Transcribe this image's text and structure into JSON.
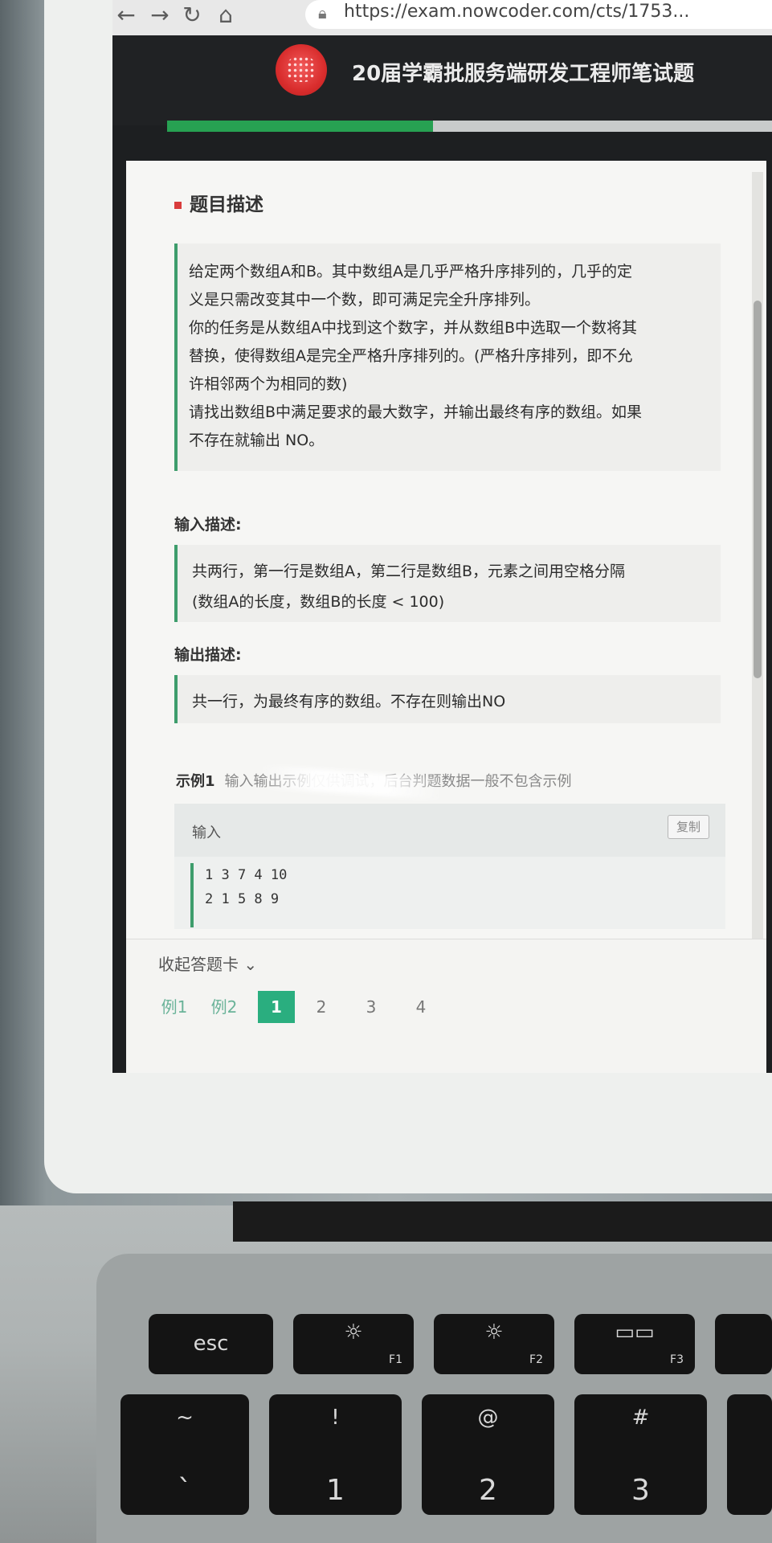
{
  "browser": {
    "url": "https://exam.nowcoder.com/cts/1753..."
  },
  "header": {
    "exam_title": "20届学霸批服务端研发工程师笔试题",
    "progress_fraction": 0.44
  },
  "problem": {
    "section_title": "题目描述",
    "description_lines": [
      "给定两个数组A和B。其中数组A是几乎严格升序排列的，几乎的定",
      "义是只需改变其中一个数，即可满足完全升序排列。",
      "你的任务是从数组A中找到这个数字，并从数组B中选取一个数将其",
      "替换，使得数组A是完全严格升序排列的。(严格升序排列，即不允",
      "许相邻两个为相同的数)",
      "请找出数组B中满足要求的最大数字，并输出最终有序的数组。如果",
      "不存在就输出 NO。"
    ],
    "input_label": "输入描述:",
    "input_lines": [
      "共两行，第一行是数组A，第二行是数组B，元素之间用空格分隔",
      "(数组A的长度，数组B的长度 < 100)"
    ],
    "output_label": "输出描述:",
    "output_lines": [
      "共一行，为最终有序的数组。不存在则输出NO"
    ],
    "example": {
      "label": "示例1",
      "note": "输入输出示例仅供调试，后台判题数据一般不包含示例",
      "io_label": "输入",
      "copy_label": "复制",
      "code_lines": [
        "1 3 7 4 10",
        "2 1 5 8 9"
      ]
    }
  },
  "answer_card": {
    "collapse_label": "收起答题卡 ⌄",
    "items": [
      "例1",
      "例2",
      "1",
      "2",
      "3",
      "4"
    ],
    "active_index": 2
  },
  "keyboard": {
    "esc": "esc",
    "f1": "F1",
    "f2": "F2",
    "f3": "F3",
    "brightness_icon": "☼",
    "mission_icon": "▭▭",
    "k1_top": "!",
    "k1": "1",
    "k2_top": "@",
    "k2": "2",
    "k3_top": "#",
    "k3": "3",
    "tilde_top": "~",
    "tilde": "`"
  },
  "colors": {
    "accent_green": "#2aae7f",
    "border_green": "#3e9d6c",
    "title_mark_red": "#d93c3c",
    "header_dark": "#202224"
  }
}
